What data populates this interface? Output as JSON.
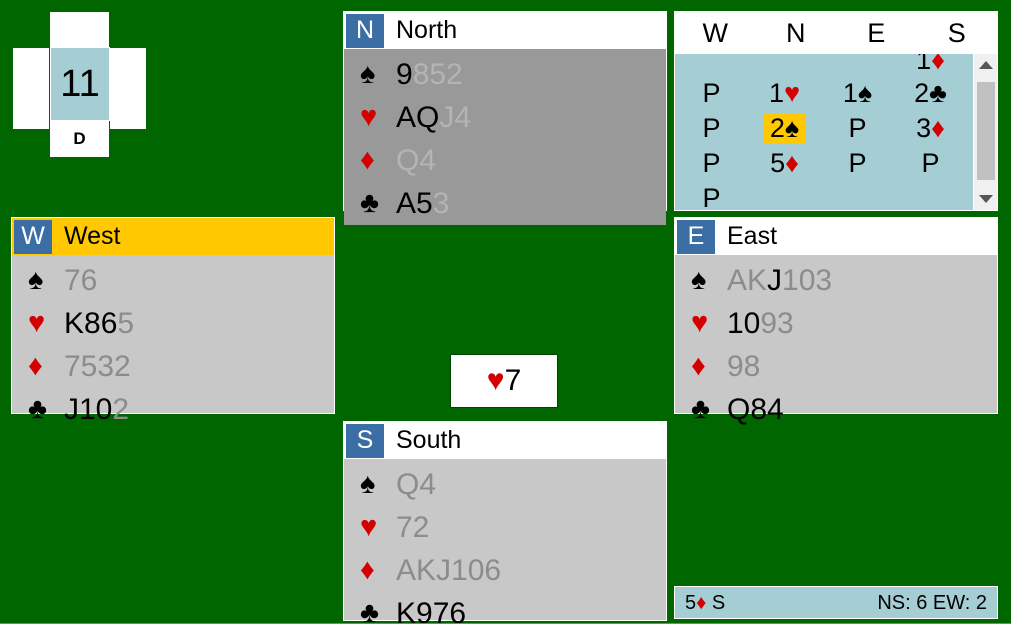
{
  "board": {
    "number": "11",
    "dealer": "D",
    "vulnerability_cells": [
      "north",
      "west",
      "east",
      "south"
    ]
  },
  "hands": {
    "north": {
      "seat": "N",
      "name": "North",
      "is_dummy": true,
      "is_active": false,
      "suits": [
        {
          "symbol": "♠",
          "color": "black",
          "held": "9",
          "played": "852"
        },
        {
          "symbol": "♥",
          "color": "red",
          "held": "AQ",
          "played": "J4"
        },
        {
          "symbol": "♦",
          "color": "red",
          "held": "",
          "played": "Q4"
        },
        {
          "symbol": "♣",
          "color": "black",
          "held": "A5",
          "played": "3"
        }
      ]
    },
    "west": {
      "seat": "W",
      "name": "West",
      "is_dummy": false,
      "is_active": true,
      "suits": [
        {
          "symbol": "♠",
          "color": "black",
          "held": "",
          "played": "76"
        },
        {
          "symbol": "♥",
          "color": "red",
          "held": "K86",
          "played": "5"
        },
        {
          "symbol": "♦",
          "color": "red",
          "held": "",
          "played": "7532"
        },
        {
          "symbol": "♣",
          "color": "black",
          "held": "J10",
          "played": "2"
        }
      ]
    },
    "east": {
      "seat": "E",
      "name": "East",
      "is_dummy": false,
      "is_active": false,
      "suits": [
        {
          "symbol": "♠",
          "color": "black",
          "played_pre": "AK",
          "held": "J",
          "played": "103"
        },
        {
          "symbol": "♥",
          "color": "red",
          "played_pre": "",
          "held": "10",
          "played": "93"
        },
        {
          "symbol": "♦",
          "color": "red",
          "played_pre": "",
          "held": "",
          "played": "98"
        },
        {
          "symbol": "♣",
          "color": "black",
          "played_pre": "",
          "held": "Q84",
          "played": ""
        }
      ]
    },
    "south": {
      "seat": "S",
      "name": "South",
      "is_dummy": false,
      "is_active": false,
      "suits": [
        {
          "symbol": "♠",
          "color": "black",
          "held": "",
          "played": "Q4"
        },
        {
          "symbol": "♥",
          "color": "red",
          "held": "",
          "played": "72"
        },
        {
          "symbol": "♦",
          "color": "red",
          "held": "",
          "played": "AKJ106"
        },
        {
          "symbol": "♣",
          "color": "black",
          "held": "K976",
          "played": ""
        }
      ]
    }
  },
  "bidding": {
    "columns": [
      "W",
      "N",
      "E",
      "S"
    ],
    "rows": [
      {
        "clipped": true,
        "cells": [
          {
            "level": "",
            "suit": "",
            "suit_color": ""
          },
          {
            "level": "",
            "suit": "",
            "suit_color": ""
          },
          {
            "level": "",
            "suit": "",
            "suit_color": ""
          },
          {
            "level": "1",
            "suit": "♦",
            "suit_color": "red"
          }
        ]
      },
      {
        "clipped": false,
        "cells": [
          {
            "level": "P",
            "suit": "",
            "suit_color": ""
          },
          {
            "level": "1",
            "suit": "♥",
            "suit_color": "red"
          },
          {
            "level": "1",
            "suit": "♠",
            "suit_color": "black"
          },
          {
            "level": "2",
            "suit": "♣",
            "suit_color": "black"
          }
        ]
      },
      {
        "clipped": false,
        "cells": [
          {
            "level": "P",
            "suit": "",
            "suit_color": ""
          },
          {
            "level": "2",
            "suit": "♠",
            "suit_color": "black",
            "highlight": true
          },
          {
            "level": "P",
            "suit": "",
            "suit_color": ""
          },
          {
            "level": "3",
            "suit": "♦",
            "suit_color": "red"
          }
        ]
      },
      {
        "clipped": false,
        "cells": [
          {
            "level": "P",
            "suit": "",
            "suit_color": ""
          },
          {
            "level": "5",
            "suit": "♦",
            "suit_color": "red"
          },
          {
            "level": "P",
            "suit": "",
            "suit_color": ""
          },
          {
            "level": "P",
            "suit": "",
            "suit_color": ""
          }
        ]
      },
      {
        "clipped": false,
        "cells": [
          {
            "level": "P",
            "suit": "",
            "suit_color": ""
          },
          {
            "level": "",
            "suit": "",
            "suit_color": ""
          },
          {
            "level": "",
            "suit": "",
            "suit_color": ""
          },
          {
            "level": "",
            "suit": "",
            "suit_color": ""
          }
        ]
      }
    ],
    "scrollbar": {
      "up_arrow": "▲",
      "down_arrow": "▼"
    }
  },
  "played_card": {
    "suit": "♥",
    "suit_color": "red",
    "rank": "7"
  },
  "status": {
    "contract_level": "5",
    "contract_suit": "♦",
    "contract_suit_color": "red",
    "declarer": "S",
    "tricks": "NS: 6 EW: 2"
  },
  "colors": {
    "table_green": "#006600",
    "panel_gray": "#c8c8c8",
    "dummy_gray": "#999999",
    "badge_blue": "#3a6ea5",
    "active_yellow": "#ffc800",
    "bidding_blue": "#a5cdd4",
    "red_suit": "#d40000"
  }
}
